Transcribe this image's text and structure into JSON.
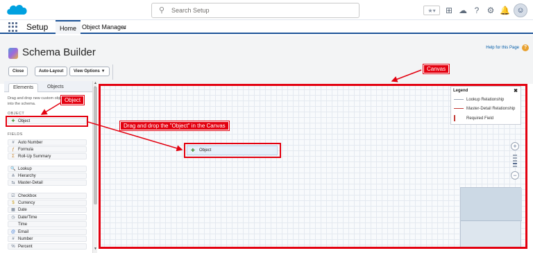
{
  "search": {
    "placeholder": "Search Setup"
  },
  "nav": {
    "app_name": "Setup",
    "tabs": [
      {
        "label": "Home"
      },
      {
        "label": "Object Manager"
      }
    ]
  },
  "header": {
    "title": "Schema Builder",
    "help_link": "Help for this Page"
  },
  "toolbar": {
    "close_label": "Close",
    "auto_layout_label": "Auto-Layout",
    "view_options_label": "View Options ▼"
  },
  "palette": {
    "tabs": [
      {
        "label": "Elements"
      },
      {
        "label": "Objects"
      }
    ],
    "hint": "Drag and drop new custom objects and fields into the schema.",
    "object_section": "OBJECT",
    "object_item": "Object",
    "fields_section": "FIELDS",
    "fields": [
      {
        "label": "Auto Number",
        "icon": "hash-icon"
      },
      {
        "label": "Formula",
        "icon": "formula-icon"
      },
      {
        "label": "Roll-Up Summary",
        "icon": "summary-icon"
      },
      {
        "label": "Lookup",
        "icon": "lookup-icon"
      },
      {
        "label": "Hierarchy",
        "icon": "hierarchy-icon"
      },
      {
        "label": "Master-Detail",
        "icon": "master-detail-icon"
      },
      {
        "label": "Checkbox",
        "icon": "checkbox-icon"
      },
      {
        "label": "Currency",
        "icon": "currency-icon"
      },
      {
        "label": "Date",
        "icon": "date-icon"
      },
      {
        "label": "Date/Time",
        "icon": "datetime-icon"
      },
      {
        "label": "Time",
        "icon": "time-icon"
      },
      {
        "label": "Email",
        "icon": "email-icon"
      },
      {
        "label": "Number",
        "icon": "number-icon"
      },
      {
        "label": "Percent",
        "icon": "percent-icon"
      }
    ]
  },
  "legend": {
    "title": "Legend",
    "close": "✖",
    "items": [
      {
        "label": "Lookup Relationship",
        "color": "#9aa5b5"
      },
      {
        "label": "Master-Detail Relationship",
        "color": "#c23934"
      },
      {
        "label": "Required Field",
        "color": "#c23934"
      }
    ]
  },
  "canvas": {
    "dropped_object_label": "Object"
  },
  "annotations": {
    "canvas_label": "Canvas",
    "object_label": "Object",
    "instruction": "Drag and drop the \"Object\" in the Canvas"
  },
  "colors": {
    "annotation_red": "#e3000f",
    "nav_blue": "#1b5297"
  }
}
